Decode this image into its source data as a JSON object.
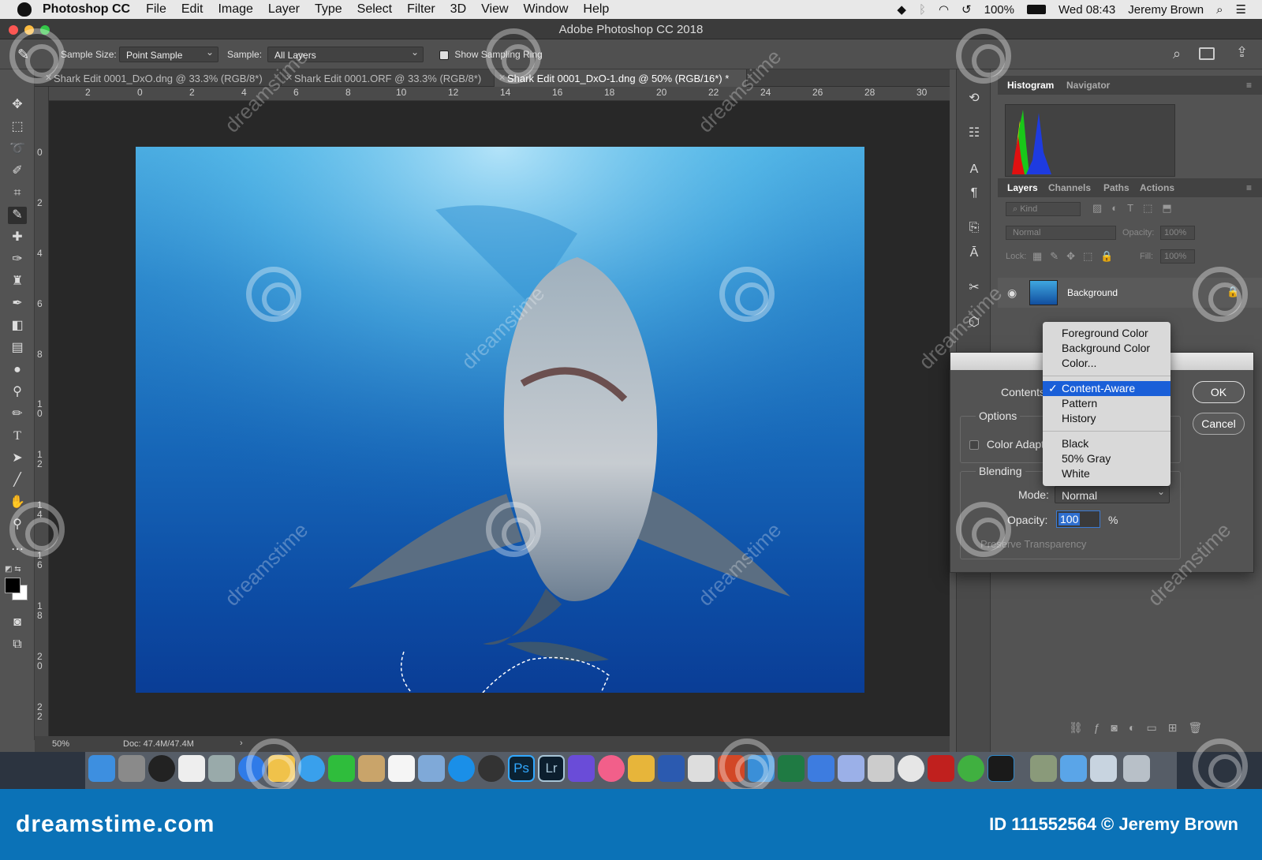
{
  "menubar": {
    "app_name": "Photoshop CC",
    "items": [
      "File",
      "Edit",
      "Image",
      "Layer",
      "Type",
      "Select",
      "Filter",
      "3D",
      "View",
      "Window",
      "Help"
    ],
    "battery": "100%",
    "clock": "Wed 08:43",
    "user": "Jeremy Brown"
  },
  "window": {
    "title": "Adobe Photoshop CC 2018"
  },
  "options_bar": {
    "sample_size_label": "Sample Size:",
    "sample_size_value": "Point Sample",
    "sample_label": "Sample:",
    "sample_value": "All Layers",
    "show_ring_label": "Show Sampling Ring",
    "show_ring_checked": true
  },
  "doc_tabs": [
    {
      "label": "Shark Edit 0001_DxO.dng @ 33.3% (RGB/8*)",
      "active": false
    },
    {
      "label": "Shark Edit 0001.ORF @ 33.3% (RGB/8*)",
      "active": false
    },
    {
      "label": "Shark Edit 0001_DxO-1.dng @ 50% (RGB/16*) *",
      "active": true
    }
  ],
  "ruler": {
    "h_ticks": [
      "2",
      "0",
      "2",
      "4",
      "6",
      "8",
      "10",
      "12",
      "14",
      "16",
      "18",
      "20",
      "22",
      "24",
      "26",
      "28",
      "30"
    ],
    "v_ticks": [
      "0",
      "2",
      "4",
      "6",
      "8",
      "1 0",
      "1 2",
      "1 4",
      "1 6",
      "1 8",
      "2 0",
      "2 2"
    ]
  },
  "status": {
    "zoom": "50%",
    "doc": "Doc: 47.4M/47.4M"
  },
  "panels": {
    "top_tabs": [
      "Histogram",
      "Navigator"
    ],
    "layer_tabs": [
      "Layers",
      "Channels",
      "Paths",
      "Actions"
    ],
    "kind_placeholder": "Kind",
    "blend_mode": "Normal",
    "opacity_label": "Opacity:",
    "opacity_value": "100%",
    "lock_label": "Lock:",
    "fill_label": "Fill:",
    "fill_value": "100%",
    "layer_name": "Background"
  },
  "fill_dialog": {
    "contents_label": "Contents",
    "options_label": "Options",
    "color_adapt_label": "Color Adapta",
    "blending_label": "Blending",
    "mode_label": "Mode:",
    "mode_value": "Normal",
    "opacity_label": "Opacity:",
    "opacity_value": "100",
    "opacity_unit": "%",
    "preserve_label": "Preserve Transparency",
    "ok_label": "OK",
    "cancel_label": "Cancel"
  },
  "contents_menu": {
    "group1": [
      "Foreground Color",
      "Background Color",
      "Color..."
    ],
    "group2": [
      "Content-Aware",
      "Pattern",
      "History"
    ],
    "group3": [
      "Black",
      "50% Gray",
      "White"
    ],
    "selected": "Content-Aware",
    "check": "✓"
  },
  "watermark": {
    "text": "dreamstime"
  },
  "footer": {
    "brand": "dreamstime.com",
    "credit": "ID 111552564 © Jeremy Brown"
  }
}
